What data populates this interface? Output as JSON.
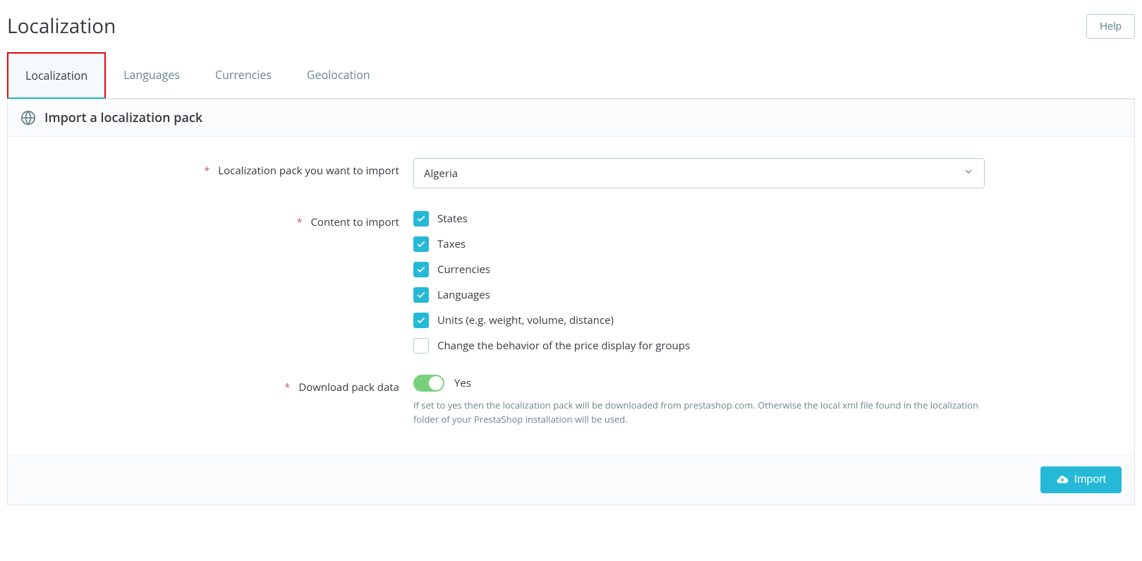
{
  "header": {
    "title": "Localization",
    "help_label": "Help"
  },
  "tabs": [
    {
      "label": "Localization",
      "active": true
    },
    {
      "label": "Languages",
      "active": false
    },
    {
      "label": "Currencies",
      "active": false
    },
    {
      "label": "Geolocation",
      "active": false
    }
  ],
  "panel": {
    "title": "Import a localization pack",
    "fields": {
      "pack_label": "Localization pack you want to import",
      "pack_selected": "Algeria",
      "content_label": "Content to import",
      "download_label": "Download pack data",
      "download_value_label": "Yes",
      "download_help": "If set to yes then the localization pack will be downloaded from prestashop.com. Otherwise the local xml file found in the localization folder of your PrestaShop installation will be used."
    },
    "content_options": [
      {
        "label": "States",
        "checked": true
      },
      {
        "label": "Taxes",
        "checked": true
      },
      {
        "label": "Currencies",
        "checked": true
      },
      {
        "label": "Languages",
        "checked": true
      },
      {
        "label": "Units (e.g. weight, volume, distance)",
        "checked": true
      },
      {
        "label": "Change the behavior of the price display for groups",
        "checked": false
      }
    ],
    "footer": {
      "import_label": "Import"
    }
  }
}
